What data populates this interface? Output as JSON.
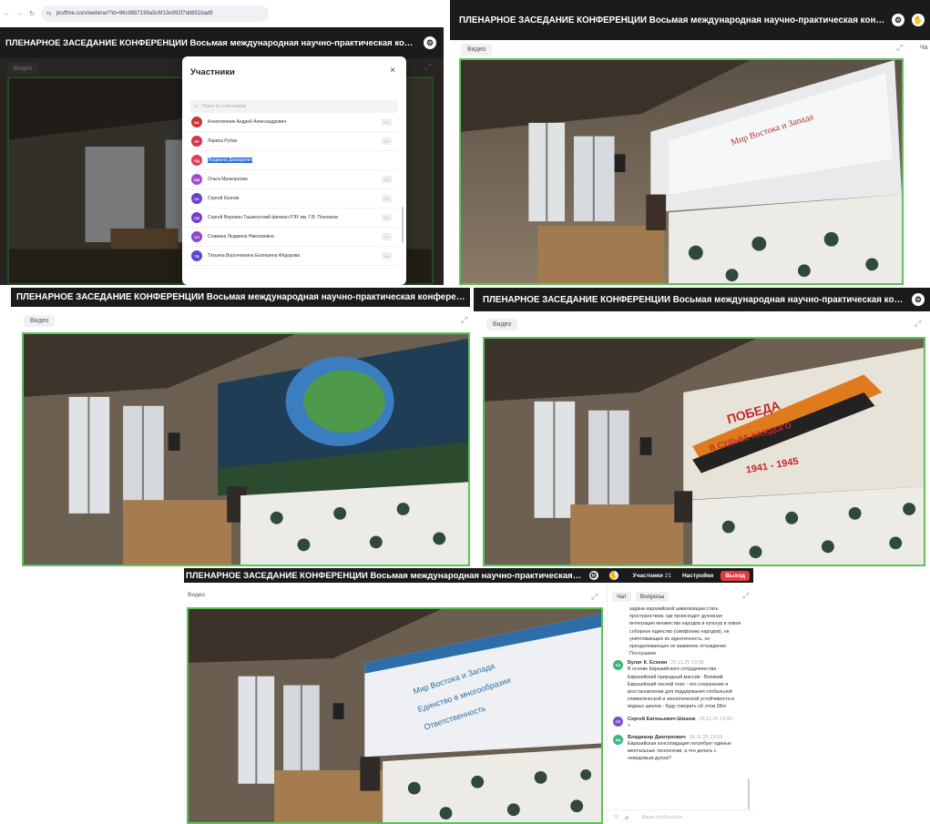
{
  "browser": {
    "url": "pruffme.com/webinar/?id=96c9887199a5c6f13e992f7dd851bad9"
  },
  "webinar": {
    "title": "ПЛЕНАРНОЕ ЗАСЕДАНИЕ КОНФЕРЕНЦИИ Восьмая международная научно-практическая конференция ...",
    "video_label": "Видео",
    "chat_tab_short": "Ча",
    "participants_label": "Участники",
    "participants_count": "21",
    "settings_label": "Настройки",
    "exit_label": "Выход"
  },
  "participants_modal": {
    "title": "Участники",
    "search_placeholder": "Поиск по участникам",
    "items": [
      {
        "initials": "КА",
        "name": "Коноплянник Андрей Александрович",
        "color": "#c43a3a"
      },
      {
        "initials": "ЛР",
        "name": "Лариса Рубан",
        "color": "#d9344f"
      },
      {
        "initials": "ЛД",
        "name": "Людмила Демиденко",
        "color": "#e0405a"
      },
      {
        "initials": "ОМ",
        "name": "Ольга Мракорнова",
        "color": "#a24bd1"
      },
      {
        "initials": "СК",
        "name": "Сергей Козлов",
        "color": "#6a3fd0"
      },
      {
        "initials": "СВ",
        "name": "Сергей Воронин Ташкентский филиал РЭУ им. Г.В. Плеханов",
        "color": "#7a3fcf"
      },
      {
        "initials": "СЛ",
        "name": "Славина Людмила Николаевна",
        "color": "#8e44c9"
      },
      {
        "initials": "ТВ",
        "name": "Татьяна Ворончихина Екатерина Фёдорова",
        "color": "#5b47d1"
      }
    ]
  },
  "slides": {
    "p2": "Мир Востока и Запада",
    "p4_top": "ПОБЕДА",
    "p4_mid": "В СУДЬБЕ КАЖДОГО",
    "p4_years": "1941 - 1945",
    "p5_lines": [
      "Мир Востока и Запада",
      "Единство в многообразии",
      "Ответственность"
    ]
  },
  "chat": {
    "tab_chat": "Чат",
    "tab_questions": "Вопросы",
    "input_placeholder": "Ваше сообщение...",
    "partial_text": "задача евразийской цивилизации стать пространством, где происходит духовная интеграция множества народов и культур в новое соборное единство (симфонию народов), не уничтожающее их идентичность, но преодолевающее их взаимное отчуждение. Послушаем",
    "messages": [
      {
        "initials": "БК",
        "color": "#3bb47a",
        "name": "Булат К. Есекин",
        "time": "26.11.25 13:38",
        "text": "В основе Евразийского сотрудничества - Евразийский природный массив - Великий Евразийский лесной пояс - его сохранение и восстановление для поддержания глобальной климатической и экологической устойчивости и водных циклов - буду говорить об этом 28го"
      },
      {
        "initials": "СЕ",
        "color": "#7b4fd0",
        "name": "Сергей Евгеньевич Шишов",
        "time": "26.11.25 13:43",
        "text": "+"
      },
      {
        "initials": "ВД",
        "color": "#3bb47a",
        "name": "Владимир Дмитриович",
        "time": "26.11.25 13:59",
        "text": "Евразийская консолидация потребует единые ментальные технологии, а что делать с неведомым духом?"
      }
    ]
  }
}
